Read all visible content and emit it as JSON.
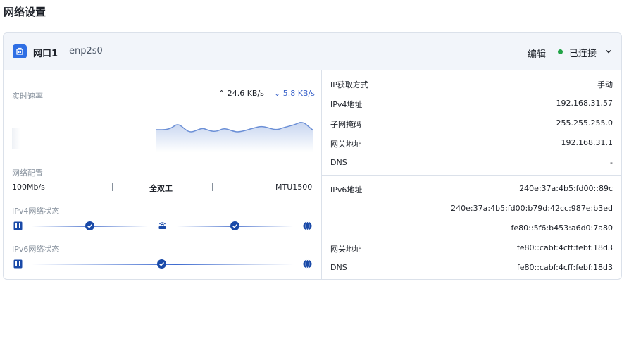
{
  "page": {
    "title": "网络设置"
  },
  "port": {
    "name": "网口1",
    "interface": "enp2s0",
    "edit_label": "编辑",
    "status": "已连接",
    "status_color": "#22a447"
  },
  "realtime": {
    "label": "实时速率",
    "upload": "24.6 KB/s",
    "download": "5.8 KB/s"
  },
  "netconfig": {
    "label": "网络配置",
    "speed": "100Mb/s",
    "duplex": "全双工",
    "mtu": "MTU1500"
  },
  "ipv4_status": {
    "label": "IPv4网络状态"
  },
  "ipv6_status": {
    "label": "IPv6网络状态"
  },
  "ipv4": {
    "rows": [
      {
        "label": "IP获取方式",
        "value": "手动"
      },
      {
        "label": "IPv4地址",
        "value": "192.168.31.57"
      },
      {
        "label": "子网掩码",
        "value": "255.255.255.0"
      },
      {
        "label": "网关地址",
        "value": "192.168.31.1"
      },
      {
        "label": "DNS",
        "value": "-"
      }
    ]
  },
  "ipv6": {
    "address_label": "IPv6地址",
    "addresses": [
      "240e:37a:4b5:fd00::89c",
      "240e:37a:4b5:fd00:b79d:42cc:987e:b3ed",
      "fe80::5f6:b453:a6d0:7a80"
    ],
    "gateway_label": "网关地址",
    "gateway": "fe80::cabf:4cff:febf:18d3",
    "dns_label": "DNS",
    "dns": "fe80::cabf:4cff:febf:18d3"
  },
  "accent_color": "#2f6fe4"
}
